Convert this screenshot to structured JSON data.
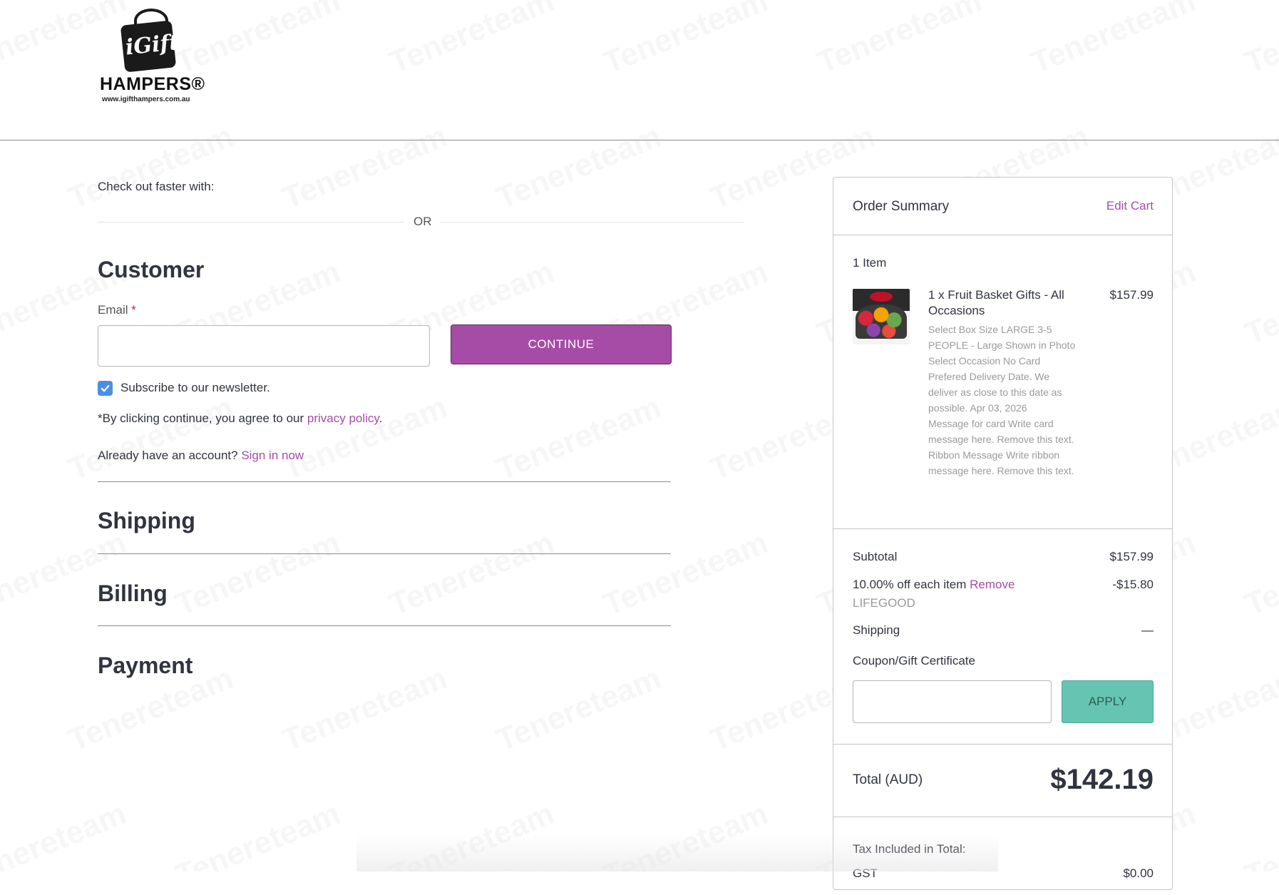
{
  "brand": {
    "logo_name": "iGift",
    "logo_hampers": "HAMPERS®",
    "logo_url": "www.igifthampers.com.au"
  },
  "checkout": {
    "faster_label": "Check out faster with:",
    "or_label": "OR",
    "customer_title": "Customer",
    "email_label": "Email",
    "email_required_mark": "*",
    "email_value": "",
    "continue_label": "CONTINUE",
    "subscribe_label": "Subscribe to our newsletter.",
    "subscribe_checked": true,
    "agree_prefix": "*By clicking continue, you agree to our ",
    "privacy_link": "privacy policy",
    "agree_suffix": ".",
    "account_prefix": "Already have an account? ",
    "sign_in_link": "Sign in now",
    "shipping_title": "Shipping",
    "billing_title": "Billing",
    "payment_title": "Payment"
  },
  "summary": {
    "title": "Order Summary",
    "edit_cart": "Edit Cart",
    "items_count": "1 Item",
    "item": {
      "name": "1 x Fruit Basket Gifts - All Occasions",
      "price": "$157.99",
      "options": [
        "Select Box Size LARGE 3-5 PEOPLE - Large Shown in Photo",
        "Select Occasion No Card",
        "Prefered Delivery Date. We deliver as close to this date as possible. Apr 03, 2026",
        "Message for card Write card message here. Remove this text.",
        "Ribbon Message Write ribbon message here. Remove this text."
      ]
    },
    "subtotal_label": "Subtotal",
    "subtotal_value": "$157.99",
    "discount_label": "10.00% off each item",
    "discount_remove": "Remove",
    "discount_code": "LIFEGOOD",
    "discount_value": "-$15.80",
    "shipping_label": "Shipping",
    "shipping_value": "—",
    "coupon_label": "Coupon/Gift Certificate",
    "coupon_value": "",
    "apply_label": "APPLY",
    "total_label": "Total (AUD)",
    "total_value": "$142.19",
    "tax_label": "Tax Included in Total:",
    "gst_label": "GST",
    "gst_value": "$0.00"
  },
  "watermark_text": "Tenereteam",
  "colors": {
    "accent_purple": "#a64ca6",
    "apply_teal": "#65c5b2",
    "checkbox_blue": "#4a90e2"
  }
}
